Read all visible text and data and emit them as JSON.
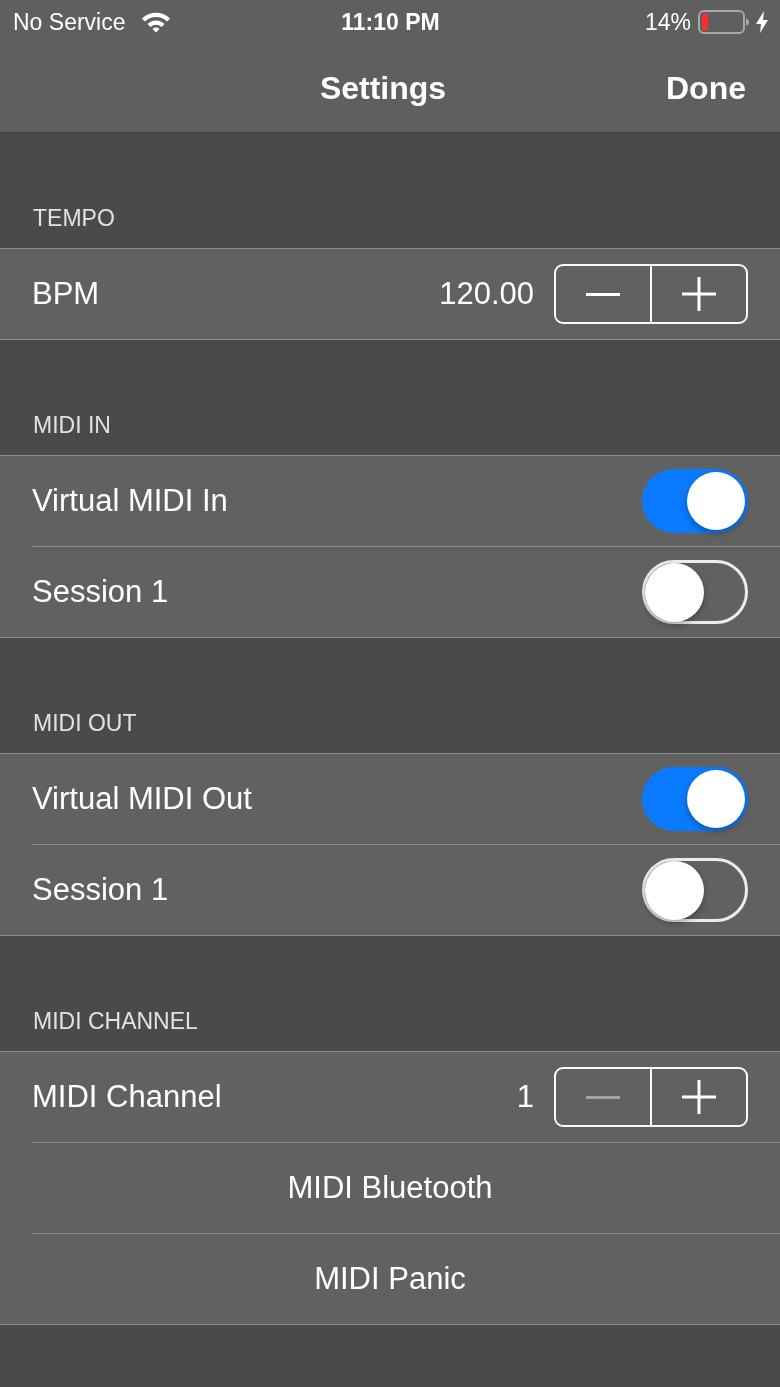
{
  "status_bar": {
    "carrier": "No Service",
    "time": "11:10 PM",
    "battery": "14%"
  },
  "nav_bar": {
    "title": "Settings",
    "done_button": "Done"
  },
  "sections": [
    {
      "header": "TEMPO",
      "rows": [
        {
          "kind": "stepper",
          "label": "BPM",
          "value": "120.00",
          "decrement_disabled": false,
          "increment_disabled": false
        }
      ]
    },
    {
      "header": "MIDI IN",
      "rows": [
        {
          "kind": "toggle",
          "label": "Virtual MIDI In",
          "on": true
        },
        {
          "kind": "toggle",
          "label": "Session 1",
          "on": false
        }
      ]
    },
    {
      "header": "MIDI OUT",
      "rows": [
        {
          "kind": "toggle",
          "label": "Virtual MIDI Out",
          "on": true
        },
        {
          "kind": "toggle",
          "label": "Session 1",
          "on": false
        }
      ]
    },
    {
      "header": "MIDI CHANNEL",
      "rows": [
        {
          "kind": "stepper",
          "label": "MIDI Channel",
          "value": "1",
          "decrement_disabled": true,
          "increment_disabled": false
        },
        {
          "kind": "action",
          "label": "MIDI Bluetooth"
        },
        {
          "kind": "action",
          "label": "MIDI Panic"
        }
      ]
    }
  ]
}
